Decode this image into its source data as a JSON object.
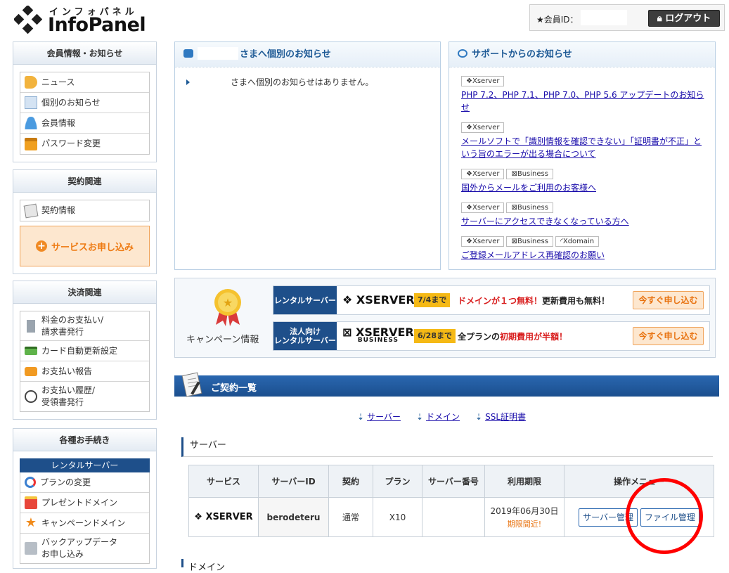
{
  "header": {
    "logo_kana": "インフォパネル",
    "logo_name": "InfoPanel",
    "member_label": "★会員ID：",
    "logout_label": "ログアウト"
  },
  "sidebar": {
    "member": {
      "title": "会員情報・お知らせ",
      "items": [
        {
          "label": "ニュース",
          "icon": "megaphone-icon"
        },
        {
          "label": "個別のお知らせ",
          "icon": "note-icon"
        },
        {
          "label": "会員情報",
          "icon": "person-icon"
        },
        {
          "label": "パスワード変更",
          "icon": "lock-icon"
        }
      ]
    },
    "contract": {
      "title": "契約関連",
      "items": [
        {
          "label": "契約情報",
          "icon": "document-icon"
        }
      ],
      "apply_button": "サービスお申し込み"
    },
    "payment": {
      "title": "決済関連",
      "items": [
        {
          "label": "料金のお支払い/\n請求書発行",
          "icon": "receipt-icon"
        },
        {
          "label": "カード自動更新設定",
          "icon": "card-icon"
        },
        {
          "label": "お支払い報告",
          "icon": "chat-icon"
        },
        {
          "label": "お支払い履歴/\n受領書発行",
          "icon": "clock-icon"
        }
      ]
    },
    "procedures": {
      "title": "各種お手続き",
      "subhead": "レンタルサーバー",
      "items": [
        {
          "label": "プランの変更",
          "icon": "refresh-icon"
        },
        {
          "label": "プレゼントドメイン",
          "icon": "gift-icon"
        },
        {
          "label": "キャンペーンドメイン",
          "icon": "star-icon"
        },
        {
          "label": "バックアップデータ\nお申し込み",
          "icon": "backup-icon"
        }
      ]
    }
  },
  "personal_notice": {
    "title": "さまへ個別のお知らせ",
    "message": "さまへ個別のお知らせはありません。"
  },
  "support_notice": {
    "title": "サポートからのお知らせ",
    "items": [
      {
        "tags": [
          "❖Xserver"
        ],
        "text": "PHP 7.2、PHP 7.1、PHP 7.0、PHP 5.6 アップデートのお知らせ"
      },
      {
        "tags": [
          "❖Xserver"
        ],
        "text": "メールソフトで「識別情報を確認できない」「証明書が不正」という旨のエラーが出る場合について"
      },
      {
        "tags": [
          "❖Xserver",
          "⊠Business"
        ],
        "text": "国外からメールをご利用のお客様へ"
      },
      {
        "tags": [
          "❖Xserver",
          "⊠Business"
        ],
        "text": "サーバーにアクセスできなくなっている方へ"
      },
      {
        "tags": [
          "❖Xserver",
          "⊠Business",
          "◜Xdomain"
        ],
        "text": "ご登録メールアドレス再確認のお願い"
      }
    ]
  },
  "campaign": {
    "label": "キャンペーン情報",
    "banners": [
      {
        "category": "レンタルサーバー",
        "brand": "XSERVER",
        "brand_sub": "",
        "date": "7/4まで",
        "msg_red": "ドメインが１つ無料！",
        "msg_rest": "更新費用も無料！",
        "cta": "今すぐ申し込む"
      },
      {
        "category": "法人向け\nレンタルサーバー",
        "brand": "XSERVER",
        "brand_sub": "BUSINESS",
        "date": "6/28まで",
        "msg_pre": "全プランの",
        "msg_red": "初期費用が半額！",
        "cta": "今すぐ申し込む"
      }
    ]
  },
  "contracts": {
    "title": "ご契約一覧",
    "anchors": [
      "サーバー",
      "ドメイン",
      "SSL証明書"
    ],
    "server_section": "サーバー",
    "columns": [
      "サービス",
      "サーバーID",
      "契約",
      "プラン",
      "サーバー番号",
      "利用期限",
      "操作メニュー"
    ],
    "rows": [
      {
        "service": "XSERVER",
        "server_id": "berodeteru",
        "contract": "通常",
        "plan": "X10",
        "number": "",
        "expiry": "2019年06月30日",
        "expiry_note": "期限間近!",
        "actions": [
          "サーバー管理",
          "ファイル管理"
        ]
      }
    ],
    "next_section": "ドメイン"
  },
  "colors": {
    "accent": "#1e4f8a",
    "orange": "#e8720f",
    "highlight_circle": "#ff0000"
  }
}
